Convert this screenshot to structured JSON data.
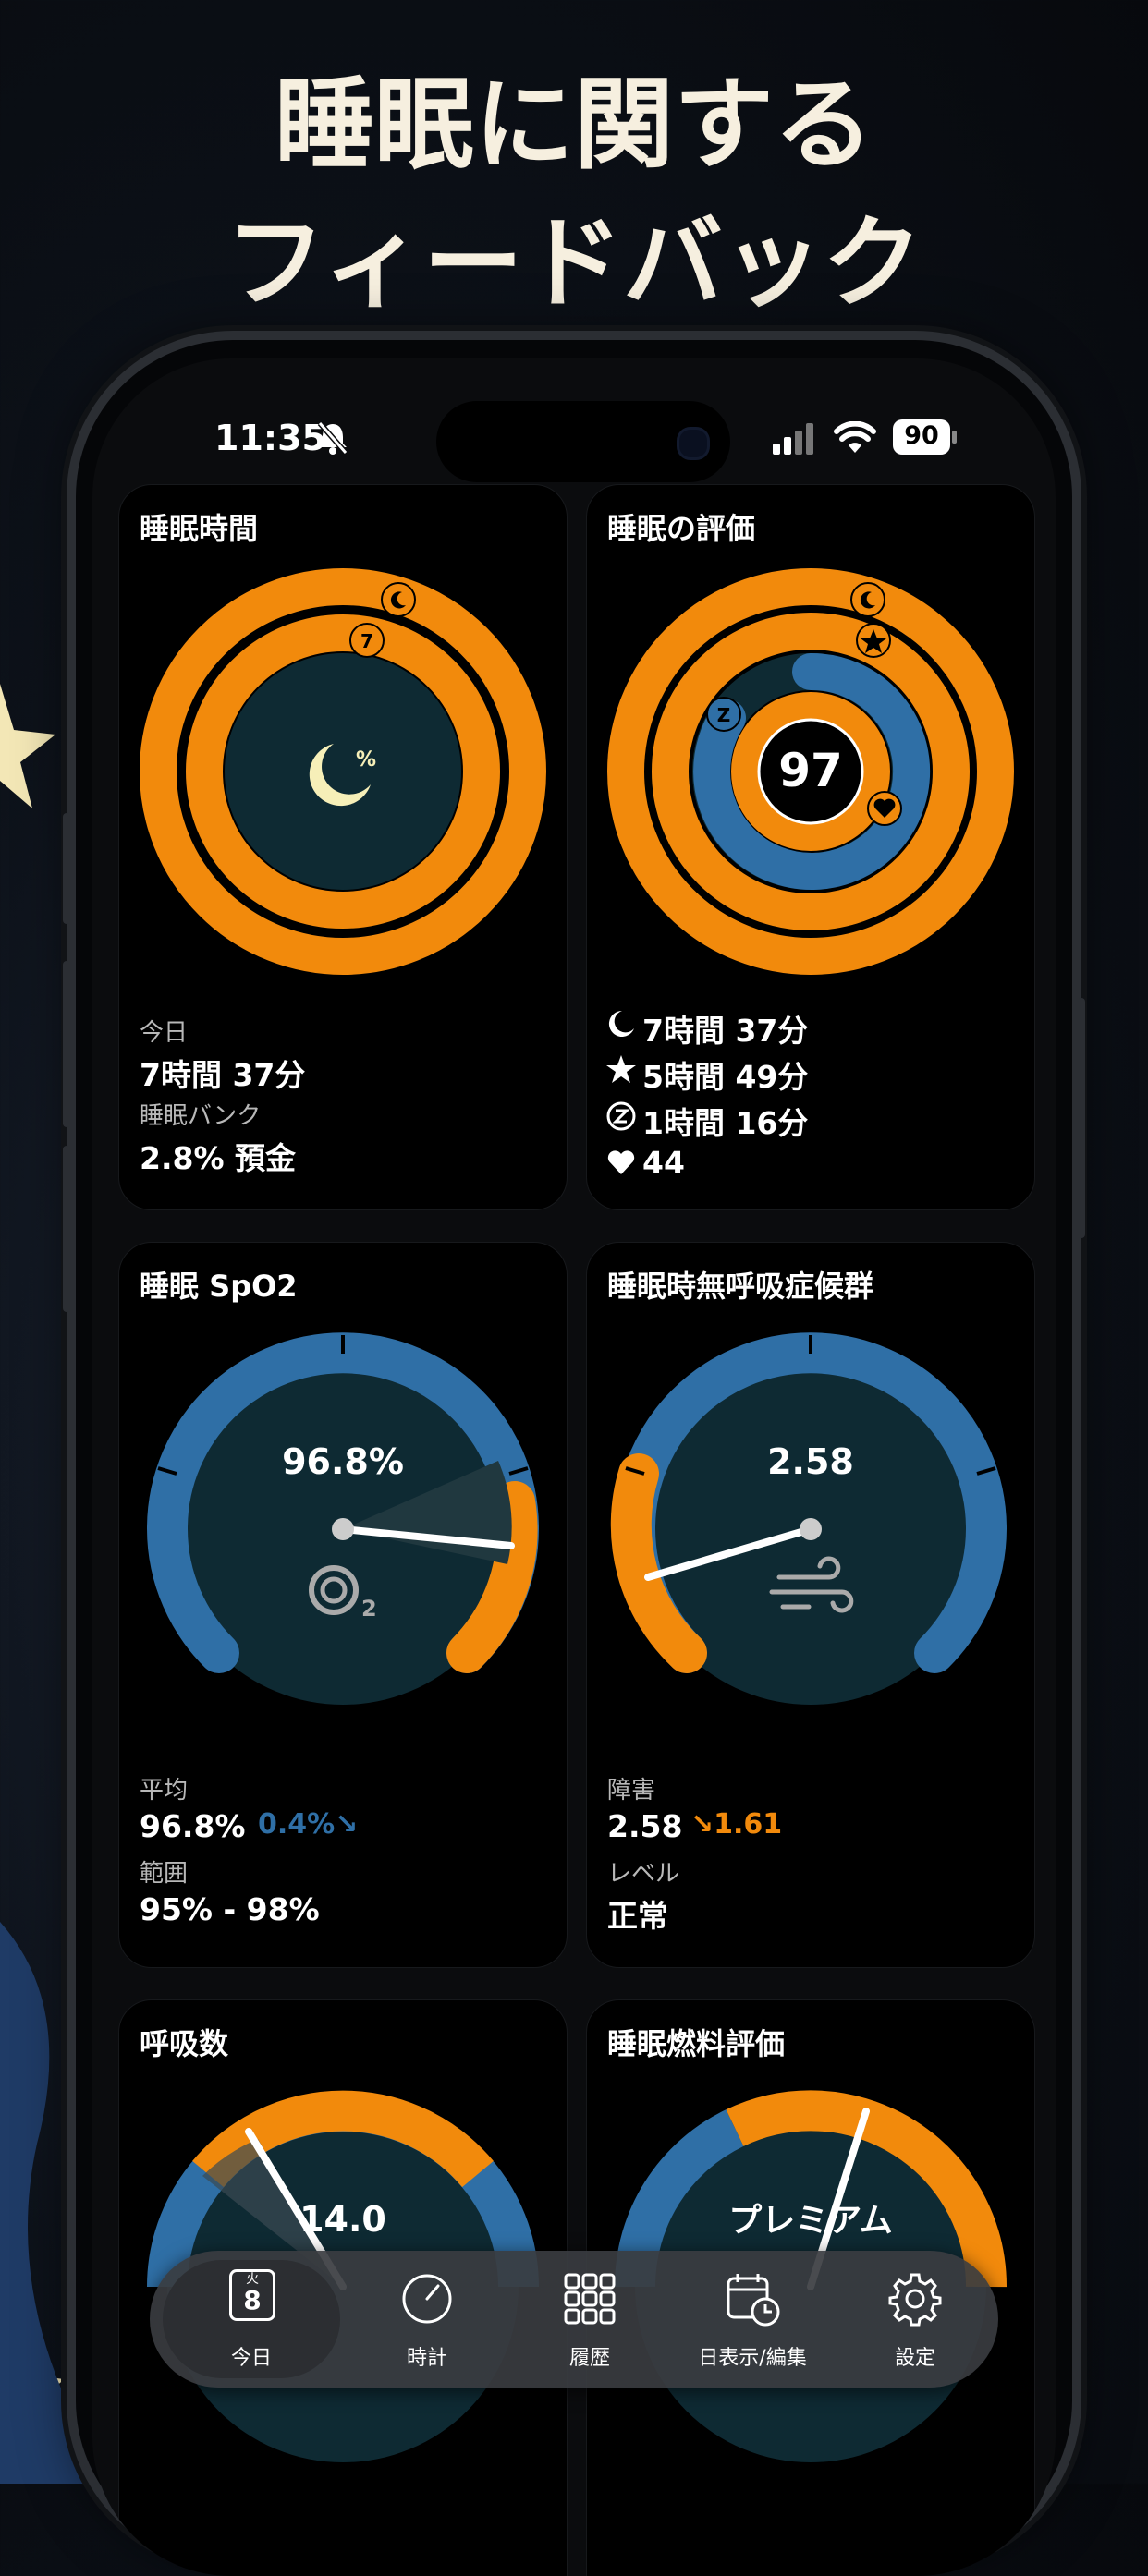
{
  "headline": {
    "line1": "睡眠に関する",
    "line2": "フィードバック"
  },
  "status_bar": {
    "time": "11:35",
    "battery": "90",
    "icons": [
      "bell-slash-icon",
      "signal-icon",
      "wifi-icon",
      "battery-icon"
    ]
  },
  "cards": {
    "sleep_time": {
      "title": "睡眠時間",
      "ring_badge": "7",
      "center_symbol": "%",
      "today_label": "今日",
      "today_value": "7時間 37分",
      "bank_label": "睡眠バンク",
      "bank_value": "2.8% 預金"
    },
    "sleep_score": {
      "title": "睡眠の評価",
      "score": "97",
      "z_badge": "Z",
      "rows": [
        {
          "icon": "moon-icon",
          "value": "7時間 37分"
        },
        {
          "icon": "star-icon",
          "value": "5時間 49分"
        },
        {
          "icon": "z-circle-icon",
          "value": "1時間 16分"
        },
        {
          "icon": "heart-icon",
          "value": "44"
        }
      ]
    },
    "spo2": {
      "title": "睡眠 SpO2",
      "gauge_value": "96.8%",
      "avg_label": "平均",
      "avg_value": "96.8%",
      "avg_change": "0.4%↘",
      "range_label": "範囲",
      "range_value": "95% - 98%"
    },
    "apnea": {
      "title": "睡眠時無呼吸症候群",
      "gauge_value": "2.58",
      "disorder_label": "障害",
      "disorder_value": "2.58",
      "disorder_change": "↘1.61",
      "level_label": "レベル",
      "level_value": "正常"
    },
    "respiration": {
      "title": "呼吸数",
      "gauge_value": "14.0"
    },
    "fuel": {
      "title": "睡眠燃料評価",
      "gauge_value": "プレミアム"
    }
  },
  "tabbar": {
    "calendar_weekday": "火",
    "calendar_day": "8",
    "tabs": [
      {
        "label": "今日",
        "icon": "calendar-icon",
        "active": true
      },
      {
        "label": "時計",
        "icon": "clock-icon",
        "active": false
      },
      {
        "label": "履歴",
        "icon": "grid-icon",
        "active": false
      },
      {
        "label": "日表示/編集",
        "icon": "calendar-clock-icon",
        "active": false
      },
      {
        "label": "設定",
        "icon": "gear-icon",
        "active": false
      }
    ]
  },
  "colors": {
    "orange": "#f28a0c",
    "blue": "#2f6fa6",
    "dark_teal": "#0e2a33",
    "cream": "#f6efdf"
  }
}
